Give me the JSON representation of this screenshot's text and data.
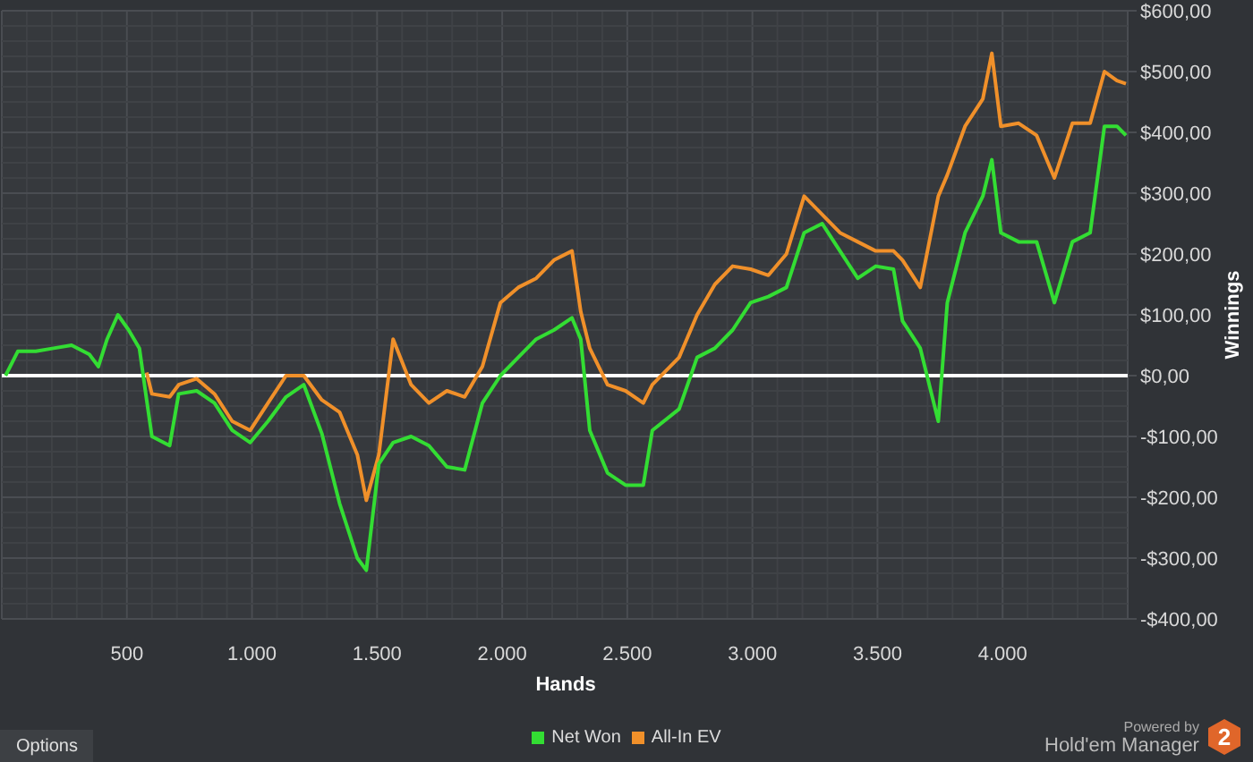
{
  "chart_data": {
    "type": "line",
    "xlabel": "Hands",
    "ylabel": "Winnings",
    "xlim": [
      0,
      4500
    ],
    "ylim": [
      -400,
      600
    ],
    "xticks": [
      {
        "value": 500,
        "label": "500"
      },
      {
        "value": 1000,
        "label": "1.000"
      },
      {
        "value": 1500,
        "label": "1.500"
      },
      {
        "value": 2000,
        "label": "2.000"
      },
      {
        "value": 2500,
        "label": "2.500"
      },
      {
        "value": 3000,
        "label": "3.000"
      },
      {
        "value": 3500,
        "label": "3.500"
      },
      {
        "value": 4000,
        "label": "4.000"
      }
    ],
    "yticks": [
      {
        "value": 600,
        "label": "$600,00"
      },
      {
        "value": 500,
        "label": "$500,00"
      },
      {
        "value": 400,
        "label": "$400,00"
      },
      {
        "value": 300,
        "label": "$300,00"
      },
      {
        "value": 200,
        "label": "$200,00"
      },
      {
        "value": 100,
        "label": "$100,00"
      },
      {
        "value": 0,
        "label": "$0,00"
      },
      {
        "value": -100,
        "label": "-$100,00"
      },
      {
        "value": -200,
        "label": "-$200,00"
      },
      {
        "value": -300,
        "label": "-$300,00"
      },
      {
        "value": -400,
        "label": "-$400,00"
      }
    ],
    "x": [
      15,
      64,
      136,
      207,
      279,
      350,
      386,
      421,
      464,
      507,
      550,
      579,
      600,
      671,
      707,
      779,
      850,
      921,
      993,
      1064,
      1136,
      1207,
      1279,
      1350,
      1421,
      1457,
      1507,
      1564,
      1636,
      1707,
      1779,
      1850,
      1921,
      1993,
      2064,
      2136,
      2207,
      2279,
      2314,
      2350,
      2421,
      2493,
      2564,
      2600,
      2707,
      2779,
      2850,
      2921,
      2993,
      3064,
      3136,
      3207,
      3279,
      3350,
      3421,
      3493,
      3564,
      3600,
      3671,
      3743,
      3779,
      3850,
      3921,
      3957,
      3993,
      4064,
      4136,
      4207,
      4279,
      4350,
      4407,
      4457,
      4493
    ],
    "series": [
      {
        "name": "Net Won",
        "color": "#33dd33",
        "values": [
          0,
          40,
          40,
          45,
          50,
          35,
          15,
          60,
          100,
          75,
          45,
          -40,
          -100,
          -115,
          -30,
          -25,
          -45,
          -90,
          -110,
          -75,
          -35,
          -15,
          -95,
          -210,
          -300,
          -320,
          -145,
          -110,
          -100,
          -115,
          -150,
          -155,
          -45,
          0,
          30,
          60,
          75,
          95,
          60,
          -90,
          -160,
          -180,
          -180,
          -90,
          -55,
          30,
          45,
          75,
          120,
          130,
          145,
          235,
          250,
          205,
          160,
          180,
          175,
          90,
          45,
          -75,
          120,
          235,
          295,
          355,
          235,
          220,
          220,
          120,
          220,
          235,
          410,
          410,
          395
        ]
      },
      {
        "name": "All-In EV",
        "color": "#f0902a",
        "values": [
          null,
          null,
          null,
          null,
          null,
          null,
          null,
          null,
          null,
          null,
          null,
          5,
          -30,
          -35,
          -15,
          -5,
          -30,
          -75,
          -90,
          -45,
          0,
          0,
          -40,
          -60,
          -130,
          -205,
          -130,
          60,
          -15,
          -45,
          -25,
          -35,
          15,
          120,
          145,
          160,
          190,
          205,
          105,
          45,
          -15,
          -25,
          -45,
          -15,
          30,
          100,
          150,
          180,
          175,
          165,
          200,
          295,
          265,
          235,
          220,
          205,
          205,
          190,
          145,
          295,
          330,
          410,
          455,
          530,
          410,
          415,
          395,
          325,
          415,
          415,
          500,
          485,
          480
        ]
      }
    ],
    "grid": true
  },
  "options_button": "Options",
  "branding": {
    "line_1": "Powered by",
    "line_2": "Hold'em Manager",
    "badge": "2"
  }
}
